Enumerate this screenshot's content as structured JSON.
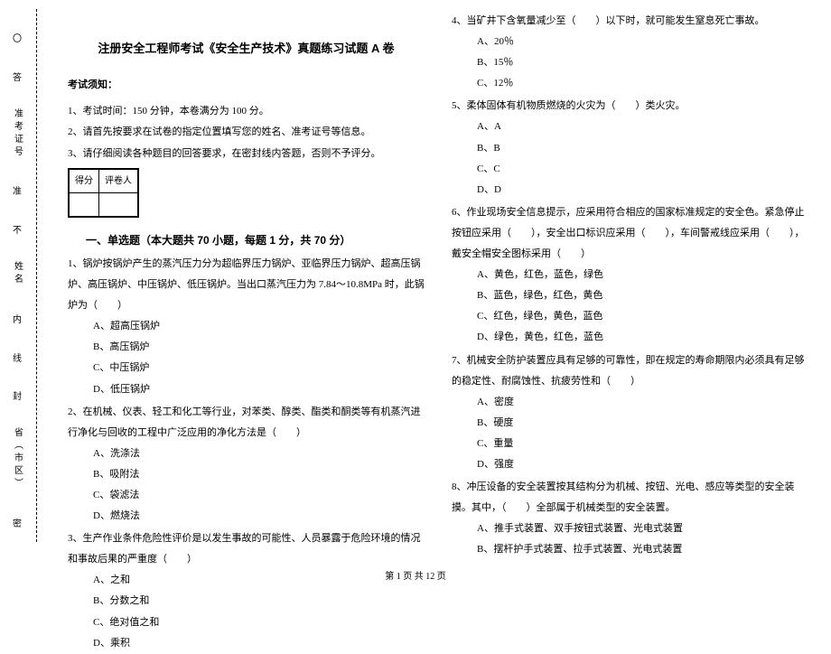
{
  "margin": {
    "labels": [
      "〇",
      "答",
      "准考证号",
      "准",
      "不",
      "姓名",
      "内",
      "线",
      "封",
      "省（市区）",
      "密"
    ]
  },
  "title": "注册安全工程师考试《安全生产技术》真题练习试题 A 卷",
  "notice_head": "考试须知：",
  "notices": [
    "1、考试时间：150 分钟，本卷满分为 100 分。",
    "2、请首先按要求在试卷的指定位置填写您的姓名、准考证号等信息。",
    "3、请仔细阅读各种题目的回答要求，在密封线内答题，否则不予评分。"
  ],
  "scorebox": {
    "c1": "得分",
    "c2": "评卷人"
  },
  "section1": "一、单选题（本大题共 70 小题，每题 1 分，共 70 分）",
  "q1": {
    "stem": "1、锅炉按锅炉产生的蒸汽压力分为超临界压力锅炉、亚临界压力锅炉、超高压锅炉、高压锅炉、中压锅炉、低压锅炉。当出口蒸汽压力为 7.84～10.8MPa 时，此锅炉为（　　）",
    "opts": [
      "A、超高压锅炉",
      "B、高压锅炉",
      "C、中压锅炉",
      "D、低压锅炉"
    ]
  },
  "q2": {
    "stem": "2、在机械、仪表、轻工和化工等行业，对苯类、醇类、酯类和酮类等有机蒸汽进行净化与回收的工程中广泛应用的净化方法是（　　）",
    "opts": [
      "A、洗涤法",
      "B、吸附法",
      "C、袋滤法",
      "D、燃烧法"
    ]
  },
  "q3": {
    "stem": "3、生产作业条件危险性评价是以发生事故的可能性、人员暴露于危险环境的情况和事故后果的严重度（　　）",
    "opts": [
      "A、之和",
      "B、分数之和",
      "C、绝对值之和",
      "D、乘积"
    ]
  },
  "q4": {
    "stem": "4、当矿井下含氧量减少至（　　）以下时，就可能发生窒息死亡事故。",
    "opts": [
      "A、20％",
      "B、15％",
      "C、12％"
    ]
  },
  "q5": {
    "stem": "5、柔体固体有机物质燃烧的火灾为（　　）类火灾。",
    "opts": [
      "A、A",
      "B、B",
      "C、C",
      "D、D"
    ]
  },
  "q6": {
    "stem": "6、作业现场安全信息提示，应采用符合相应的国家标准规定的安全色。紧急停止按钮应采用（　　），安全出口标识应采用（　　），车间警戒线应采用（　　），戴安全帽安全图标采用（　　）",
    "opts": [
      "A、黄色，红色，蓝色，绿色",
      "B、蓝色，绿色，红色，黄色",
      "C、红色，绿色，黄色，蓝色",
      "D、绿色，黄色，红色，蓝色"
    ]
  },
  "q7": {
    "stem": "7、机械安全防护装置应具有足够的可靠性，即在规定的寿命期限内必须具有足够的稳定性、耐腐蚀性、抗疲劳性和（　　）",
    "opts": [
      "A、密度",
      "B、硬度",
      "C、重量",
      "D、强度"
    ]
  },
  "q8": {
    "stem": "8、冲压设备的安全装置按其结构分为机械、按钮、光电、感应等类型的安全装摸。其中，（　　）全部属于机械类型的安全装置。",
    "opts": [
      "A、推手式装置、双手按钮式装置、光电式装置",
      "B、摆杆护手式装置、拉手式装置、光电式装置"
    ]
  },
  "footer": "第 1 页 共 12 页"
}
